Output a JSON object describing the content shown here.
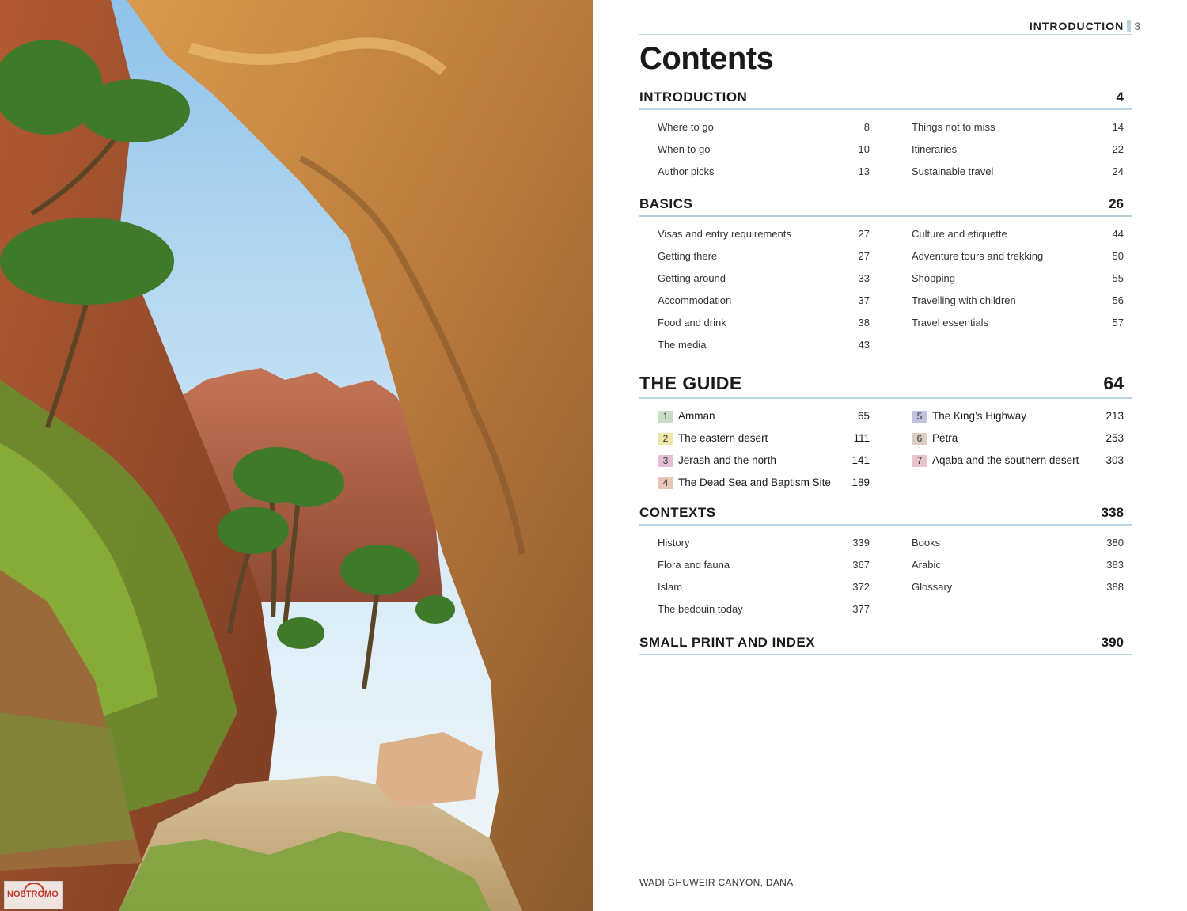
{
  "running_header": {
    "section": "INTRODUCTION",
    "page": "3"
  },
  "title": "Contents",
  "sections": {
    "introduction": {
      "name": "INTRODUCTION",
      "page": "4",
      "left": [
        {
          "label": "Where to go",
          "page": "8"
        },
        {
          "label": "When to go",
          "page": "10"
        },
        {
          "label": "Author picks",
          "page": "13"
        }
      ],
      "right": [
        {
          "label": "Things not to miss",
          "page": "14"
        },
        {
          "label": "Itineraries",
          "page": "22"
        },
        {
          "label": "Sustainable travel",
          "page": "24"
        }
      ]
    },
    "basics": {
      "name": "BASICS",
      "page": "26",
      "left": [
        {
          "label": "Visas and entry requirements",
          "page": "27"
        },
        {
          "label": "Getting there",
          "page": "27"
        },
        {
          "label": "Getting around",
          "page": "33"
        },
        {
          "label": "Accommodation",
          "page": "37"
        },
        {
          "label": "Food and drink",
          "page": "38"
        },
        {
          "label": "The media",
          "page": "43"
        }
      ],
      "right": [
        {
          "label": "Culture and etiquette",
          "page": "44"
        },
        {
          "label": "Adventure tours and trekking",
          "page": "50"
        },
        {
          "label": "Shopping",
          "page": "55"
        },
        {
          "label": "Travelling with children",
          "page": "56"
        },
        {
          "label": "Travel essentials",
          "page": "57"
        }
      ]
    },
    "guide": {
      "name": "THE GUIDE",
      "page": "64",
      "left": [
        {
          "num": "1",
          "label": "Amman",
          "page": "65",
          "color": "#c8dcc6"
        },
        {
          "num": "2",
          "label": "The eastern desert",
          "page": "111",
          "color": "#efe6a8"
        },
        {
          "num": "3",
          "label": "Jerash and the north",
          "page": "141",
          "color": "#e6bdd6"
        },
        {
          "num": "4",
          "label": "The Dead Sea and Baptism Site",
          "page": "189",
          "color": "#e8c6b6"
        }
      ],
      "right": [
        {
          "num": "5",
          "label": "The King’s Highway",
          "page": "213",
          "color": "#c2c2de"
        },
        {
          "num": "6",
          "label": "Petra",
          "page": "253",
          "color": "#dcccc2"
        },
        {
          "num": "7",
          "label": "Aqaba and the southern desert",
          "page": "303",
          "color": "#e6c6cc"
        }
      ]
    },
    "contexts": {
      "name": "CONTEXTS",
      "page": "338",
      "left": [
        {
          "label": "History",
          "page": "339"
        },
        {
          "label": "Flora and fauna",
          "page": "367"
        },
        {
          "label": "Islam",
          "page": "372"
        },
        {
          "label": "The bedouin today",
          "page": "377"
        }
      ],
      "right": [
        {
          "label": "Books",
          "page": "380"
        },
        {
          "label": "Arabic",
          "page": "383"
        },
        {
          "label": "Glossary",
          "page": "388"
        }
      ]
    },
    "small_print": {
      "name": "SMALL PRINT AND INDEX",
      "page": "390"
    }
  },
  "caption": "WADI GHUWEIR CANYON, DANA",
  "watermark": "NOSTROMO"
}
